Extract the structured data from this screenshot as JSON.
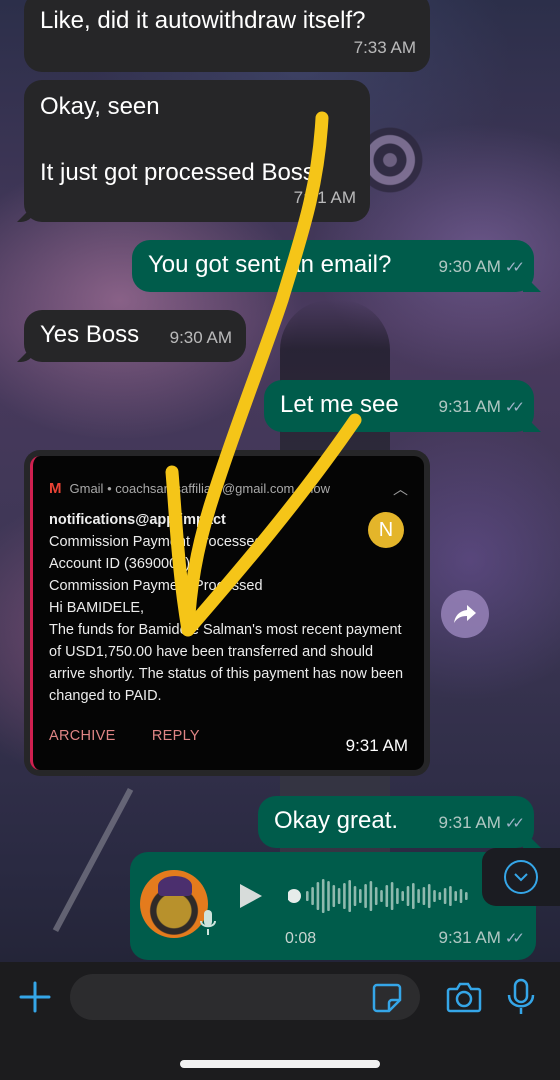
{
  "messages": [
    {
      "id": "m1",
      "text": "Like, did it autowithdraw itself?",
      "time": "7:33 AM"
    },
    {
      "id": "m2",
      "text": "Okay, seen\n\nIt just got processed Boss",
      "time": "7:31 AM"
    },
    {
      "id": "m3",
      "text": "You got sent an email?",
      "time": "9:30 AM"
    },
    {
      "id": "m4",
      "text": "Yes Boss",
      "time": "9:30 AM"
    },
    {
      "id": "m5",
      "text": "Let me see",
      "time": "9:31 AM"
    },
    {
      "id": "m6",
      "text": "Okay great.",
      "time": "9:31 AM"
    }
  ],
  "read_ticks": "✓✓",
  "image_message": {
    "time": "9:31 AM",
    "notification": {
      "app": "Gmail",
      "account": "coachsamsaffiliate@gmail.com",
      "when": "now",
      "avatar_letter": "N",
      "sender": "notifications@app.impact",
      "lines": [
        "Commission Payment Processed",
        "Account ID (3690008)",
        "Commission Payment Processed",
        "Hi BAMIDELE,",
        "The funds for Bamidele Salman's most recent payment of USD1,750.00 have been transferred and should arrive shortly. The status of this payment has now been changed to PAID."
      ],
      "actions": [
        "ARCHIVE",
        "REPLY"
      ]
    }
  },
  "voice_note": {
    "duration": "0:08",
    "time": "9:31 AM"
  },
  "colors": {
    "incoming_bubble": "#262628",
    "outgoing_bubble": "#005c4b",
    "accent_blue": "#35a6e8",
    "scribble_yellow": "#f5c518"
  },
  "icons": [
    "forward-icon",
    "play-icon",
    "mic-icon",
    "chevron-down-icon",
    "plus-icon",
    "sticker-icon",
    "camera-icon"
  ],
  "input": {
    "placeholder": ""
  }
}
